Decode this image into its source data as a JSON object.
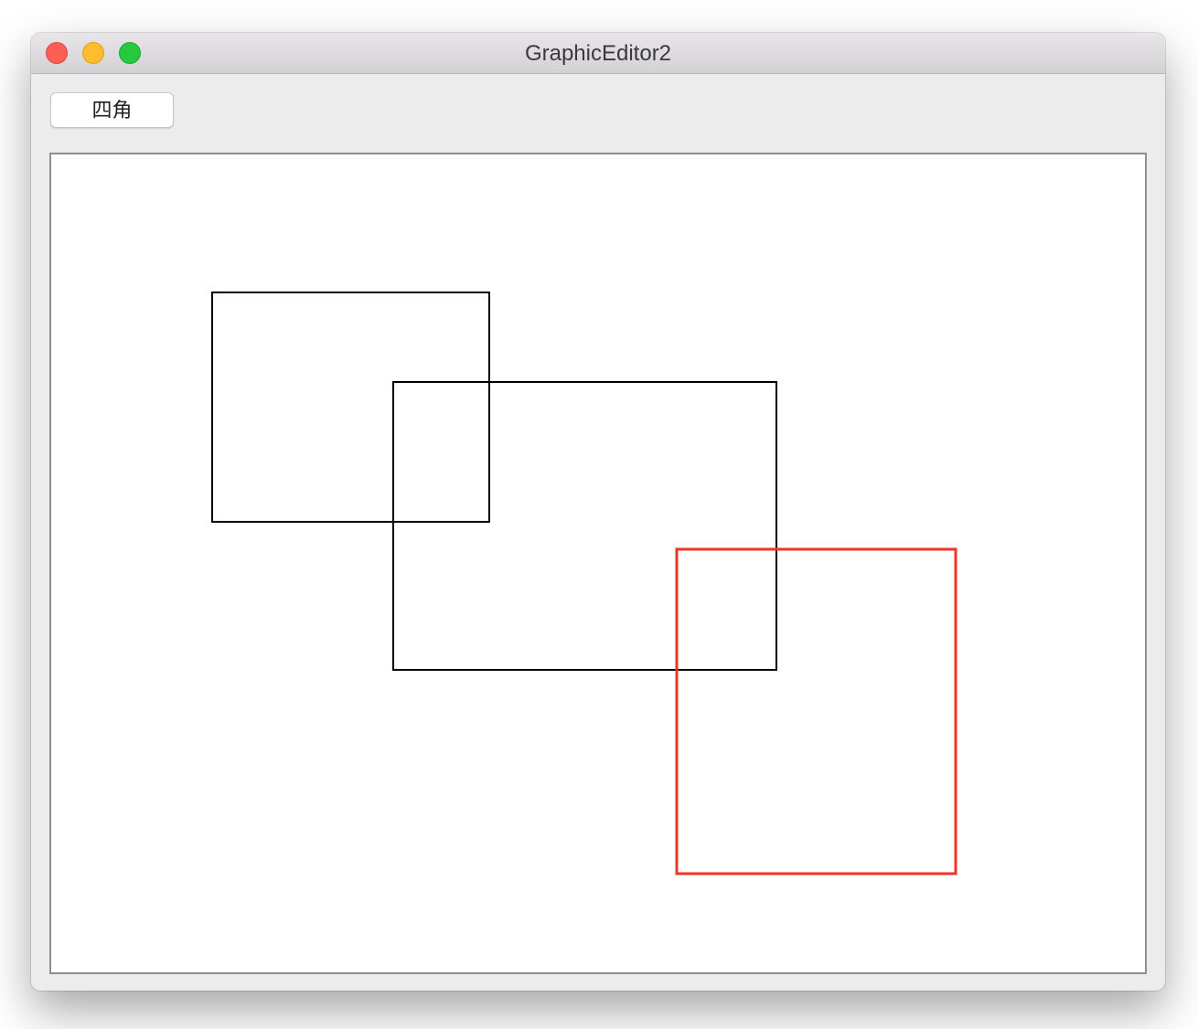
{
  "window": {
    "title": "GraphicEditor2"
  },
  "toolbar": {
    "rect_button_label": "四角"
  },
  "canvas": {
    "background": "#ffffff",
    "shapes": [
      {
        "name": "rectangle-1",
        "type": "rect",
        "stroke": "#000000",
        "selected": false
      },
      {
        "name": "rectangle-2",
        "type": "rect",
        "stroke": "#000000",
        "selected": false
      },
      {
        "name": "rectangle-3",
        "type": "rect",
        "stroke": "#f03323",
        "selected": true
      }
    ]
  },
  "colors": {
    "close": "#fd5f57",
    "minimize": "#febc2e",
    "zoom": "#28c840",
    "selection": "#f03323"
  }
}
